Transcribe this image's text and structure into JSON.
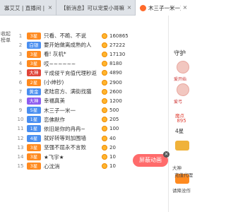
{
  "tabs": [
    {
      "label": "寡艾艾 | 直播间 | 酷狗繁",
      "close": "×"
    },
    {
      "label": "【新消息】可以宠爱小哥嘛 | 直播间",
      "close": "×"
    },
    {
      "label": "木三子一米一直播间 - 酷",
      "close": "×"
    }
  ],
  "sidebar": {
    "heading": "收起榜单"
  },
  "ranking": [
    {
      "rank": "1",
      "level": "3星",
      "level_color": "orange",
      "name": "只看、不跪、不说",
      "score": "160865"
    },
    {
      "rank": "2",
      "level": "白银",
      "level_color": "blue",
      "name": "要开始做离成熟的人",
      "score": "27222"
    },
    {
      "rank": "3",
      "level": "3星",
      "level_color": "orange",
      "name": "看! 灰机*",
      "score": "17130"
    },
    {
      "rank": "4",
      "level": "3星",
      "level_color": "orange",
      "name": "哎~~~~~~",
      "score": "8180"
    },
    {
      "rank": "5",
      "level": "大神",
      "level_color": "red",
      "name": "〒成侵〒充值代理秒返",
      "score": "4890"
    },
    {
      "rank": "6",
      "level": "2星",
      "level_color": "orange",
      "name": "(小绅抄)",
      "score": "2900"
    },
    {
      "rank": "7",
      "level": "黄金",
      "level_color": "blue",
      "name": "老陆官方、满街找猫",
      "score": "2600"
    },
    {
      "rank": "8",
      "level": "大神",
      "level_color": "purple",
      "name": "幸福真美",
      "score": "1200"
    },
    {
      "rank": "9",
      "level": "5星",
      "level_color": "blue",
      "name": "木三子一米一",
      "score": "500"
    },
    {
      "rank": "10",
      "level": "1星",
      "level_color": "blue",
      "name": "恋佛默作",
      "score": "205"
    },
    {
      "rank": "11",
      "level": "1星",
      "level_color": "blue",
      "name": "依旧是你的冉冉~",
      "score": "100"
    },
    {
      "rank": "12",
      "level": "4星",
      "level_color": "blue",
      "name": "就好转等到加围墙",
      "score": "40"
    },
    {
      "rank": "13",
      "level": "3星",
      "level_color": "orange",
      "name": "坚强不屈永不言败",
      "score": "20"
    },
    {
      "rank": "14",
      "level": "3星",
      "level_color": "orange",
      "name": "★飞宇★",
      "score": "10"
    },
    {
      "rank": "15",
      "level": "3星",
      "level_color": "orange",
      "name": "心沈消",
      "score": "10"
    }
  ],
  "right_panel": {
    "title": "守护",
    "items": [
      {
        "label": "爱开始"
      },
      {
        "label": "爱弓"
      }
    ],
    "hot_label": "魔点",
    "hot_value": "895",
    "fans_count": "4星",
    "lines": [
      "大神",
      "充值代理",
      "请降没作"
    ]
  },
  "floating": {
    "label": "屏蔽动画",
    "close": "×"
  }
}
